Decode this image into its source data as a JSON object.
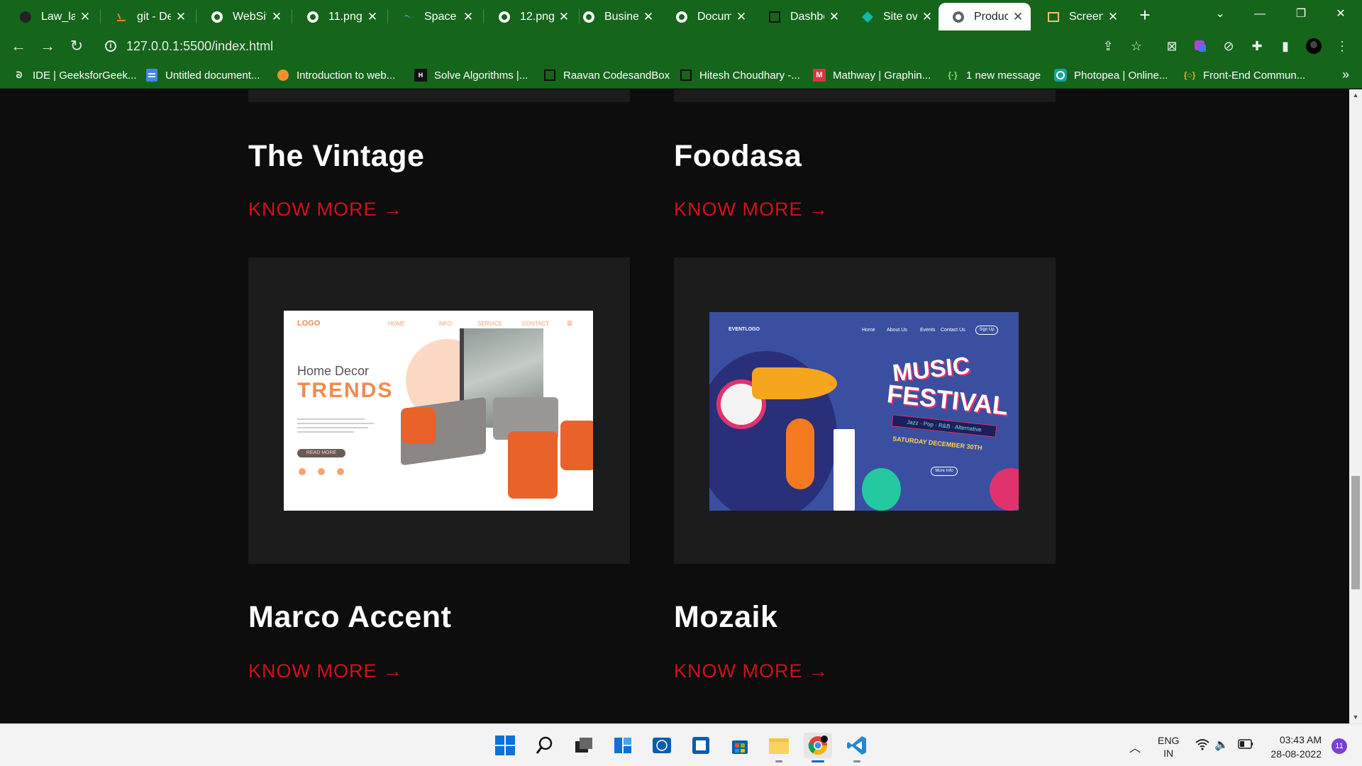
{
  "browser": {
    "tabs": [
      {
        "title": "Law_lan",
        "icon": "github-icon"
      },
      {
        "title": "git - De",
        "icon": "stackoverflow-icon"
      },
      {
        "title": "WebSite",
        "icon": "globe-icon"
      },
      {
        "title": "11.png",
        "icon": "globe-icon"
      },
      {
        "title": "Space B",
        "icon": "tailwind-icon"
      },
      {
        "title": "12.png",
        "icon": "globe-icon"
      },
      {
        "title": "Busines",
        "icon": "globe-icon"
      },
      {
        "title": "Docum",
        "icon": "globe-icon"
      },
      {
        "title": "Dashbo",
        "icon": "codesandbox-icon"
      },
      {
        "title": "Site ove",
        "icon": "netlify-icon"
      },
      {
        "title": "Product",
        "icon": "globe-icon",
        "active": true
      },
      {
        "title": "Screens",
        "icon": "screenshot-icon"
      }
    ],
    "url": "127.0.0.1:5500/index.html",
    "bookmarks": [
      {
        "label": "IDE | GeeksforGeek...",
        "icon": "gfg-icon"
      },
      {
        "label": "Untitled document...",
        "icon": "google-docs-icon"
      },
      {
        "label": "Introduction to web...",
        "icon": "orange-circle-icon"
      },
      {
        "label": "Solve Algorithms |...",
        "icon": "hackerrank-icon"
      },
      {
        "label": "Raavan CodesandBox",
        "icon": "codesandbox-icon"
      },
      {
        "label": "Hitesh Choudhary -...",
        "icon": "codesandbox-icon"
      },
      {
        "label": "Mathway | Graphin...",
        "icon": "mathway-icon"
      },
      {
        "label": "1 new message",
        "icon": "chat-bracket-icon"
      },
      {
        "label": "Photopea | Online...",
        "icon": "photopea-icon"
      },
      {
        "label": "Front-End Commun...",
        "icon": "frontend-mentor-icon"
      }
    ],
    "bookmarks_more": "»"
  },
  "page": {
    "projects": [
      {
        "title": "The Vintage",
        "cta": "KNOW MORE →"
      },
      {
        "title": "Foodasa",
        "cta": "KNOW MORE →"
      },
      {
        "title": "Marco Accent",
        "cta": "KNOW MORE →"
      },
      {
        "title": "Mozaik",
        "cta": "KNOW MORE →"
      }
    ],
    "thumb1": {
      "logo": "LOGO",
      "nav": [
        "HOME",
        "INFO",
        "SERVICE",
        "CONTACT"
      ],
      "heading": "Home  Decor",
      "headline": "TRENDS",
      "button": "READ MORE"
    },
    "thumb2": {
      "logo": "EVENTLOGO",
      "nav": [
        "Home",
        "About Us",
        "Events",
        "Contact Us"
      ],
      "signup": "Sign Up",
      "line1": "MUSIC",
      "line2": "FESTIVAL",
      "genres": "Jazz · Pop · R&B · Alternative",
      "date": "SATURDAY DECEMBER 30TH",
      "button": "More Info"
    }
  },
  "taskbar": {
    "apps": [
      "windows-start-icon",
      "search-icon",
      "task-view-icon",
      "widgets-icon",
      "dell-icon",
      "terminal-icon",
      "store-icon",
      "file-explorer-icon",
      "chrome-icon",
      "vscode-icon"
    ],
    "lang": "ENG",
    "region": "IN",
    "time": "03:43 AM",
    "date": "28-08-2022",
    "notifications": "11"
  },
  "colors": {
    "chrome_green": "#15651a",
    "page_bg": "#0d0d0d",
    "card_bg": "#1c1c1c",
    "accent_red": "#d0101b"
  }
}
